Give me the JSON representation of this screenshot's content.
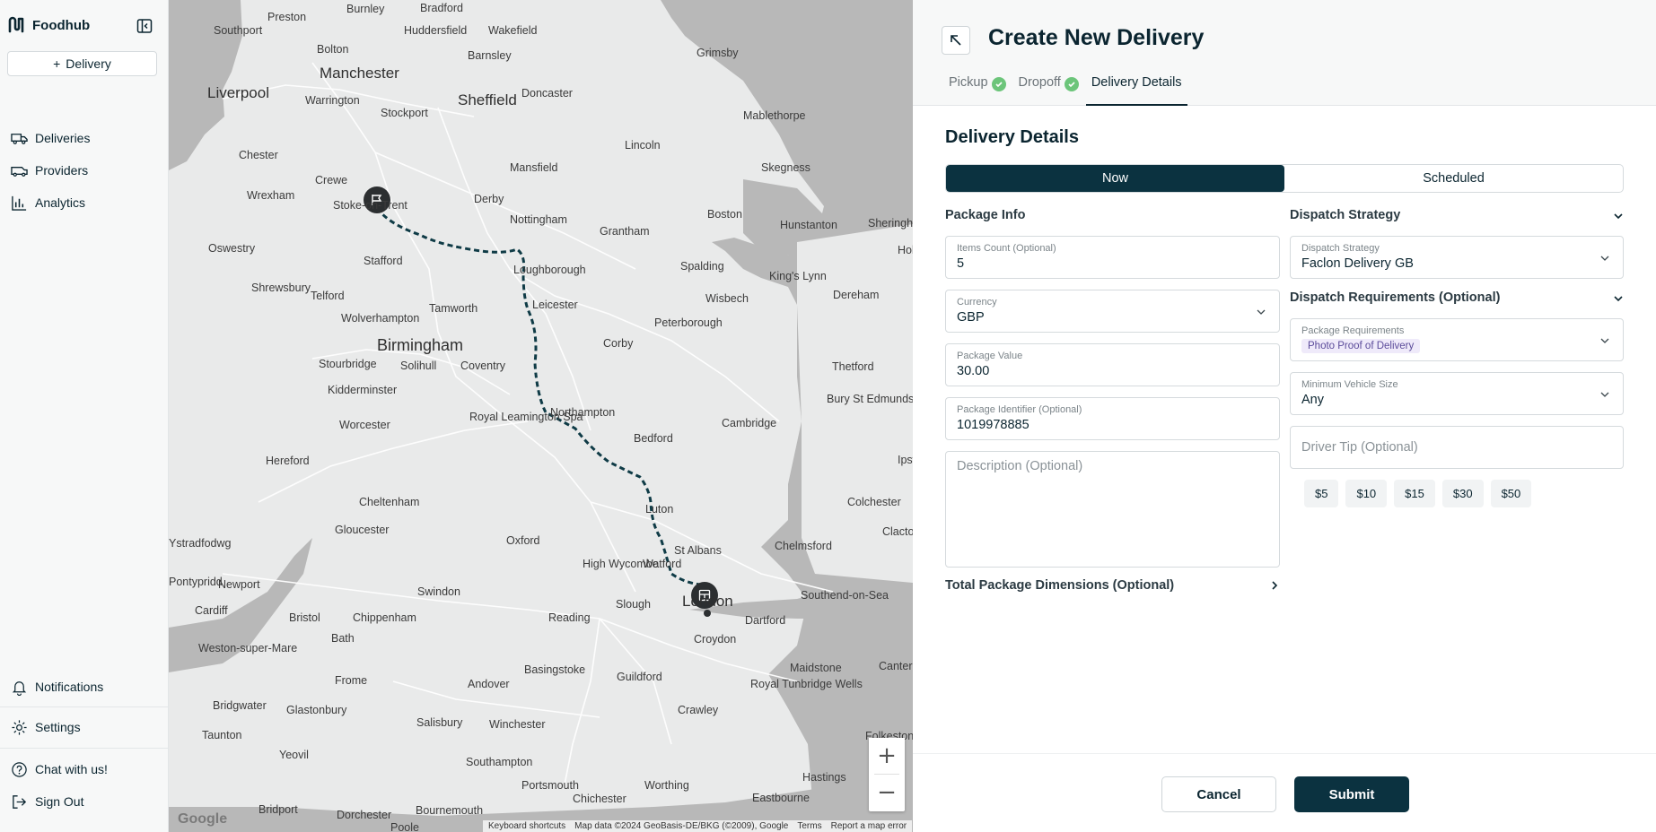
{
  "app": {
    "name": "Foodhub"
  },
  "sidebar": {
    "new_delivery_label": "Delivery",
    "items": [
      {
        "label": "Deliveries",
        "icon": "truck-icon"
      },
      {
        "label": "Providers",
        "icon": "van-icon"
      },
      {
        "label": "Analytics",
        "icon": "bar-chart-icon"
      }
    ],
    "bottom": [
      {
        "label": "Notifications",
        "icon": "bell-icon"
      },
      {
        "label": "Settings",
        "icon": "gear-icon"
      },
      {
        "label": "Chat with us!",
        "icon": "help-circle-icon"
      },
      {
        "label": "Sign Out",
        "icon": "sign-out-icon"
      }
    ]
  },
  "map": {
    "labels": [
      "Preston",
      "Burnley",
      "Bradford",
      "Wakefield",
      "Southport",
      "Bolton",
      "Huddersfield",
      "Grimsby",
      "Manchester",
      "Barnsley",
      "Doncaster",
      "Liverpool",
      "Warrington",
      "Stockport",
      "Sheffield",
      "Mablethorpe",
      "Lincoln",
      "Chester",
      "Crewe",
      "Mansfield",
      "Skegness",
      "Wrexham",
      "Stoke-on-Trent",
      "Derby",
      "Nottingham",
      "Grantham",
      "Boston",
      "Hunstanton",
      "Oswestry",
      "Stafford",
      "Loughborough",
      "Spalding",
      "King's Lynn",
      "Shrewsbury",
      "Telford",
      "Tamworth",
      "Leicester",
      "Wisbech",
      "Dereham",
      "Wolverhampton",
      "Peterborough",
      "Birmingham",
      "Corby",
      "Stourbridge",
      "Solihull",
      "Coventry",
      "Thetford",
      "Kidderminster",
      "Bury St Edmunds",
      "Northampton",
      "Worcester",
      "Royal Leamington Spa",
      "Bedford",
      "Cambridge",
      "Hereford",
      "Cheltenham",
      "Luton",
      "Colchester",
      "Gloucester",
      "Oxford",
      "St Albans",
      "Chelmsford",
      "Ystradfodwg",
      "High Wycombe",
      "Watford",
      "Pontypridd",
      "Newport",
      "Swindon",
      "Southend-on-Sea",
      "Cardiff",
      "Bristol",
      "Chippenham",
      "Reading",
      "Slough",
      "London",
      "Dartford",
      "Weston-super-Mare",
      "Bath",
      "Croydon",
      "Basingstoke",
      "Guildford",
      "Maidstone",
      "Frome",
      "Andover",
      "Royal Tunbridge Wells",
      "Canterbury",
      "Bridgwater",
      "Glastonbury",
      "Salisbury",
      "Winchester",
      "Crawley",
      "Taunton",
      "Yeovil",
      "Southampton",
      "Folkestone",
      "Portsmouth",
      "Worthing",
      "Hastings",
      "Bridport",
      "Dorchester",
      "Bournemouth",
      "Chichester",
      "Eastbourne",
      "Poole",
      "Sheringham",
      "Holt",
      "Ipswich",
      "Clacton"
    ],
    "zoom_in": "+",
    "zoom_out": "−",
    "google": "Google",
    "attribution": [
      "Keyboard shortcuts",
      "Map data ©2024 GeoBasis-DE/BKG (©2009), Google",
      "Terms",
      "Report a map error"
    ]
  },
  "panel": {
    "title": "Create New Delivery",
    "tabs": [
      {
        "label": "Pickup",
        "done": true
      },
      {
        "label": "Dropoff",
        "done": true
      },
      {
        "label": "Delivery Details",
        "active": true
      }
    ],
    "section_title": "Delivery Details",
    "timing": {
      "now": "Now",
      "scheduled": "Scheduled",
      "selected": "Now"
    },
    "package_info": {
      "heading": "Package Info",
      "items_count": {
        "label": "Items Count (Optional)",
        "value": "5"
      },
      "currency": {
        "label": "Currency",
        "value": "GBP"
      },
      "package_value": {
        "label": "Package Value",
        "value": "30.00"
      },
      "package_identifier": {
        "label": "Package Identifier (Optional)",
        "value": "1019978885"
      },
      "description": {
        "placeholder": "Description (Optional)"
      },
      "dimensions": "Total Package Dimensions (Optional)"
    },
    "dispatch": {
      "strategy_heading": "Dispatch Strategy",
      "strategy": {
        "label": "Dispatch Strategy",
        "value": "Faclon Delivery GB"
      },
      "requirements_heading": "Dispatch Requirements (Optional)",
      "package_requirements": {
        "label": "Package Requirements",
        "value": "Photo Proof of Delivery"
      },
      "vehicle": {
        "label": "Minimum Vehicle Size",
        "value": "Any"
      },
      "tip": {
        "placeholder": "Driver Tip (Optional)"
      },
      "tips": [
        "$5",
        "$10",
        "$15",
        "$30",
        "$50"
      ]
    },
    "cancel": "Cancel",
    "submit": "Submit"
  },
  "colors": {
    "primary": "#0b3240",
    "success": "#6cc57a",
    "map_bg": "#e9eaea",
    "sea": "#b7b7b7"
  }
}
